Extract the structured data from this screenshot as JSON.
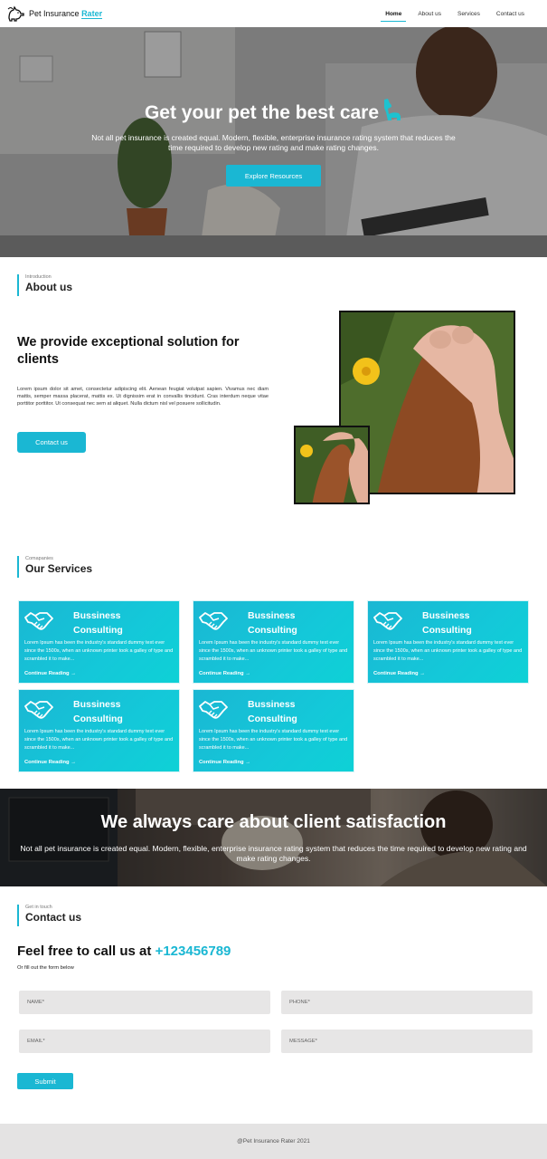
{
  "nav": {
    "brand_prefix": "Pet Insurance",
    "brand_accent": "Rater",
    "links": [
      {
        "label": "Home",
        "active": true
      },
      {
        "label": "About us",
        "active": false
      },
      {
        "label": "Services",
        "active": false
      },
      {
        "label": "Contact us",
        "active": false
      }
    ]
  },
  "hero": {
    "title": "Get your pet the best care",
    "subtitle": "Not all pet insurance is created equal. Modern, flexible, enterprise insurance rating system that reduces the time required to develop new rating and make rating changes.",
    "button_label": "Explore Resources"
  },
  "about": {
    "kicker": "Introduction",
    "title": "About us",
    "heading": "We provide exceptional solution for clients",
    "body": "Lorem ipsum dolor sit amet, consectetur adipiscing elit. Aenean feugiat volutpat sapien. Vivamus nec diam mattis, semper massa placerat, mattis ex. Ut dignissim erat in convallis tincidunt. Cras interdum neque vitae porttitor porttitor. Ut consequat nec sem at aliquet. Nulla dictum nisl vel posuere sollicitudin.",
    "button_label": "Contact us"
  },
  "services": {
    "kicker": "Comapanies",
    "title": "Our Services",
    "cards": [
      {
        "title_line1": "Bussiness",
        "title_line2": "Consulting",
        "text": "Lorem Ipsum has been the industry's standard dummy text ever since the 1500s, when an unknown printer took a galley of type and scrambled it to make...",
        "link": "Continue Reading →"
      },
      {
        "title_line1": "Bussiness",
        "title_line2": "Consulting",
        "text": "Lorem Ipsum has been the industry's standard dummy text ever since the 1500s, when an unknown printer took a galley of type and scrambled it to make...",
        "link": "Continue Reading →"
      },
      {
        "title_line1": "Bussiness",
        "title_line2": "Consulting",
        "text": "Lorem Ipsum has been the industry's standard dummy text ever since the 1500s, when an unknown printer took a galley of type and scrambled it to make...",
        "link": "Continue Reading →"
      },
      {
        "title_line1": "Bussiness",
        "title_line2": "Consulting",
        "text": "Lorem Ipsum has been the industry's standard dummy text ever since the 1500s, when an unknown printer took a galley of type and scrambled it to make...",
        "link": "Continue Reading →"
      },
      {
        "title_line1": "Bussiness",
        "title_line2": "Consulting",
        "text": "Lorem Ipsum has been the industry's standard dummy text ever since the 1500s, when an unknown printer took a galley of type and scrambled it to make...",
        "link": "Continue Reading →"
      }
    ]
  },
  "band": {
    "title": "We always care about client satisfaction",
    "subtitle": "Not all pet insurance is created equal. Modern, flexible, enterprise insurance rating system that reduces the time required to develop new rating and make rating changes."
  },
  "contact": {
    "kicker": "Get in touch",
    "title": "Contact us",
    "heading_prefix": "Feel free to call us at",
    "phone": "+123456789",
    "sub": "Or fill out the form below",
    "fields": {
      "name": "NAME*",
      "phone": "PHONE*",
      "email": "EMAIL*",
      "message": "MESSAGE*"
    },
    "submit_label": "Submit"
  },
  "footer": {
    "text": "@Pet Insurance Rater 2021"
  },
  "colors": {
    "accent": "#1ab7d3",
    "footer_bg": "#e4e3e3",
    "field_bg": "#e7e6e6"
  },
  "icons": {
    "brand": "dog-cat-logo-icon",
    "hero": "dog-icon",
    "service": "handshake-icon"
  }
}
